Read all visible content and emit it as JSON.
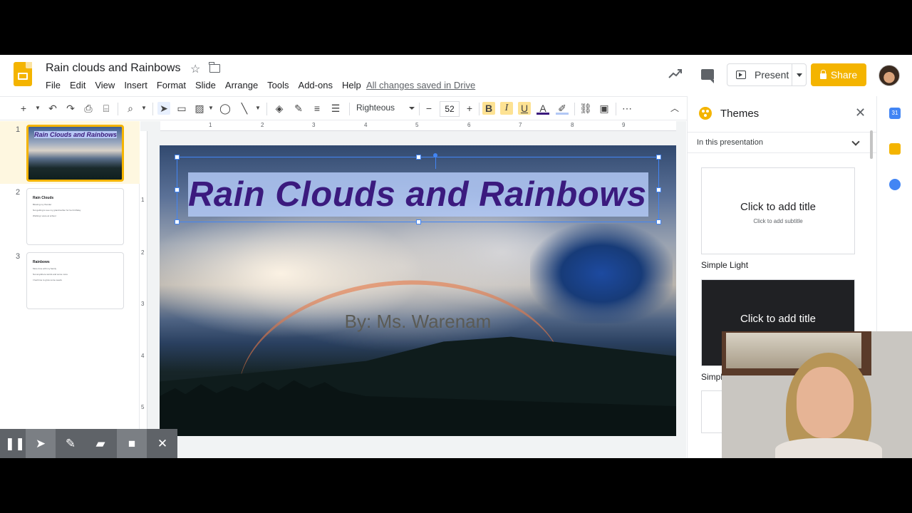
{
  "header": {
    "doc_title": "Rain clouds and Rainbows",
    "menu": [
      "File",
      "Edit",
      "View",
      "Insert",
      "Format",
      "Slide",
      "Arrange",
      "Tools",
      "Add-ons",
      "Help"
    ],
    "save_status": "All changes saved in Drive",
    "present_label": "Present",
    "share_label": "Share"
  },
  "toolbar": {
    "font": "Righteous",
    "font_size": "52"
  },
  "filmstrip": {
    "slides": [
      {
        "number": "1",
        "title": "Rain Clouds and Rainbows"
      },
      {
        "number": "2",
        "title": "Rain Clouds",
        "lines": [
          "Blowing my thunder",
          "Not getting to see my grandmother for her birthday",
          "Wishing I were at school"
        ]
      },
      {
        "number": "3",
        "title": "Rainbows",
        "lines": [
          "More time with my family",
          "Not anywhere words and some more",
          "I had time to grow some seeds"
        ]
      }
    ]
  },
  "ruler": {
    "top": [
      "1",
      "2",
      "3",
      "4",
      "5",
      "6",
      "7",
      "8",
      "9"
    ],
    "left": [
      "1",
      "2",
      "3",
      "4",
      "5"
    ]
  },
  "slide": {
    "title": "Rain Clouds and Rainbows",
    "subtitle": "By: Ms. Warenam"
  },
  "themes": {
    "panel_title": "Themes",
    "section": "In this presentation",
    "cards": [
      {
        "title": "Click to add title",
        "subtitle": "Click to add subtitle",
        "name": "Simple Light",
        "style": "light"
      },
      {
        "title": "Click to add title",
        "subtitle": "",
        "name": "Simple Dark",
        "style": "dark"
      }
    ]
  },
  "rail": {
    "calendar_label": "31"
  },
  "colors": {
    "accent": "#f4b400",
    "selection": "#4285f4",
    "title_text": "#3b1a7e",
    "title_highlight": "#b2c8f5"
  }
}
